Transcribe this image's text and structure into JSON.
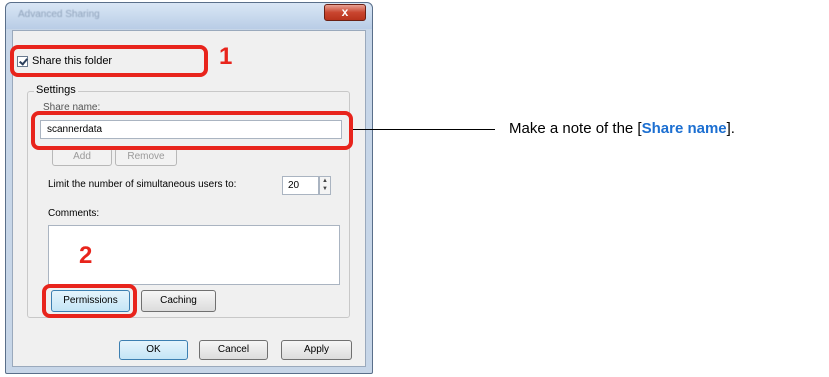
{
  "window": {
    "title": "Advanced Sharing",
    "close_label": "x"
  },
  "share_checkbox": {
    "label": "Share this folder",
    "checked": true
  },
  "settings": {
    "group_label": "Settings",
    "share_name_label": "Share name:",
    "share_name_value": "scannerdata",
    "add_label": "Add",
    "remove_label": "Remove",
    "limit_label": "Limit the number of simultaneous users to:",
    "limit_value": "20",
    "comments_label": "Comments:"
  },
  "buttons": {
    "permissions": "Permissions",
    "caching": "Caching",
    "ok": "OK",
    "cancel": "Cancel",
    "apply": "Apply"
  },
  "annotations": {
    "step1": "1",
    "step2": "2",
    "note_prefix": "Make a note of the [",
    "note_highlight": "Share name",
    "note_suffix": "].",
    "highlight_color": "#e8241c",
    "note_color": "#1c6fd1"
  }
}
